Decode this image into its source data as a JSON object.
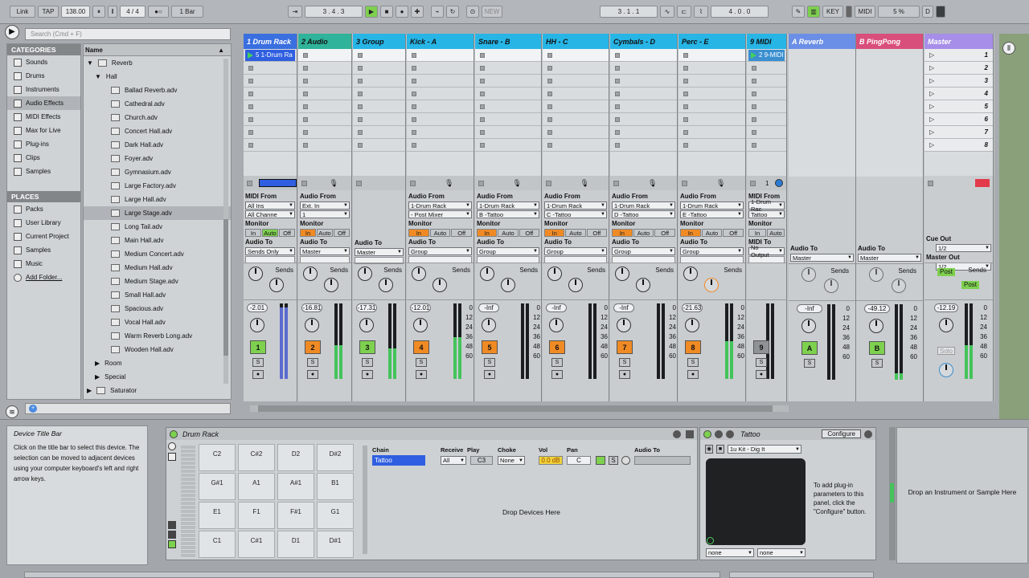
{
  "transport": {
    "link": "Link",
    "tap": "TAP",
    "tempo": "138.00",
    "sig": "4 / 4",
    "quant": "1 Bar",
    "pos1": "3 .  4 .  3",
    "pos2": "3 .  1 .  1",
    "pos3": "4 .  0 .  0",
    "new": "NEW",
    "key": "KEY",
    "midi": "MIDI",
    "cpu": "5 %",
    "d": "D"
  },
  "browser": {
    "search": "Search (Cmd + F)",
    "categories_title": "CATEGORIES",
    "categories": [
      "Sounds",
      "Drums",
      "Instruments",
      "Audio Effects",
      "MIDI Effects",
      "Max for Live",
      "Plug-ins",
      "Clips",
      "Samples"
    ],
    "places_title": "PLACES",
    "places": [
      "Packs",
      "User Library",
      "Current Project",
      "Samples",
      "Music",
      "Add Folder..."
    ],
    "name_col": "Name",
    "reverb": "Reverb",
    "hall": "Hall",
    "files": [
      "Ballad Reverb.adv",
      "Cathedral.adv",
      "Church.adv",
      "Concert Hall.adv",
      "Dark Hall.adv",
      "Foyer.adv",
      "Gymnasium.adv",
      "Large Factory.adv",
      "Large Hall.adv",
      "Large Stage.adv",
      "Long Tail.adv",
      "Main Hall.adv",
      "Medium Concert.adv",
      "Medium Hall.adv",
      "Medium Stage.adv",
      "Small Hall.adv",
      "Spacious.adv",
      "Vocal Hall.adv",
      "Warm Reverb Long.adv",
      "Wooden Hall.adv"
    ],
    "room": "Room",
    "special": "Special",
    "saturator": "Saturator"
  },
  "tracks": [
    {
      "name": "1 Drum Rack",
      "color": "#3a6fe0",
      "clip": "5 1-Drum Ra",
      "from_label": "MIDI From",
      "from": "All Ins",
      "chan": "All Channe",
      "to": "Sends Only",
      "vol": "-2.01",
      "num": "1",
      "numcol": "#7ed04f"
    },
    {
      "name": "2 Audio",
      "color": "#2fb39a",
      "clip": "",
      "from_label": "Audio From",
      "from": "Ext. In",
      "chan": "1",
      "to": "Master",
      "vol": "-16.81",
      "num": "2",
      "numcol": "#f08a24"
    },
    {
      "name": "3 Group",
      "color": "#27b5e6",
      "clip": "",
      "from_label": "",
      "from": "",
      "chan": "",
      "to": "Master",
      "vol": "-17.31",
      "num": "3",
      "numcol": "#7ed04f"
    },
    {
      "name": "Kick - A",
      "color": "#27b5e6",
      "clip": "",
      "from_label": "Audio From",
      "from": "1-Drum Rack",
      "chan": "- Post Mixer",
      "to": "Group",
      "vol": "-12.01",
      "num": "4",
      "numcol": "#f08a24"
    },
    {
      "name": "Snare - B",
      "color": "#27b5e6",
      "clip": "",
      "from_label": "Audio From",
      "from": "1-Drum Rack",
      "chan": "B -Tattoo",
      "to": "Group",
      "vol": "-Inf",
      "num": "5",
      "numcol": "#f08a24"
    },
    {
      "name": "HH - C",
      "color": "#27b5e6",
      "clip": "",
      "from_label": "Audio From",
      "from": "1-Drum Rack",
      "chan": "C -Tattoo",
      "to": "Group",
      "vol": "-Inf",
      "num": "6",
      "numcol": "#f08a24"
    },
    {
      "name": "Cymbals - D",
      "color": "#27b5e6",
      "clip": "",
      "from_label": "Audio From",
      "from": "1-Drum Rack",
      "chan": "D -Tattoo",
      "to": "Group",
      "vol": "-Inf",
      "num": "7",
      "numcol": "#f08a24"
    },
    {
      "name": "Perc - E",
      "color": "#27b5e6",
      "clip": "",
      "from_label": "Audio From",
      "from": "1-Drum Rack",
      "chan": "E -Tattoo",
      "to": "Group",
      "vol": "-21.63",
      "num": "8",
      "numcol": "#f08a24"
    },
    {
      "name": "9 MIDI",
      "color": "#27b5e6",
      "clip": "2 9-MIDI",
      "from_label": "MIDI From",
      "from": "1-Drum Rac",
      "chan": "Tattoo",
      "to": "No Output",
      "vol": "",
      "num": "9",
      "numcol": "#8f9396"
    }
  ],
  "returns": [
    {
      "name": "A Reverb",
      "color": "#6b8fe6",
      "vol": "-Inf",
      "num": "A"
    },
    {
      "name": "B PingPong",
      "color": "#d94f7c",
      "vol": "-49.12",
      "num": "B"
    }
  ],
  "master": {
    "name": "Master",
    "color": "#a78ee8",
    "scenes": [
      "1",
      "2",
      "3",
      "4",
      "5",
      "6",
      "7",
      "8"
    ],
    "cue_label": "Cue Out",
    "cue": "1/2",
    "master_out_label": "Master Out",
    "master_out": "1/2",
    "vol": "-12.19",
    "solo": "Solo",
    "post": "Post"
  },
  "labels": {
    "monitor": "Monitor",
    "in": "In",
    "auto": "Auto",
    "off": "Off",
    "audio_to": "Audio To",
    "sends": "Sends",
    "s": "S",
    "midi_to": "MIDI To"
  },
  "scale": [
    "0",
    "12",
    "24",
    "36",
    "48",
    "60"
  ],
  "info": {
    "title": "Device Title Bar",
    "body": "Click on the title bar to select this device. The selection can be moved to adjacent devices using your computer keyboard's left and right arrow keys."
  },
  "drumrack": {
    "title": "Drum Rack",
    "pads": [
      [
        "C2",
        "C#2",
        "D2",
        "D#2"
      ],
      [
        "G#1",
        "A1",
        "A#1",
        "B1"
      ],
      [
        "E1",
        "F1",
        "F#1",
        "G1"
      ],
      [
        "C1",
        "C#1",
        "D1",
        "D#1"
      ]
    ],
    "cols": {
      "chain": "Chain",
      "receive": "Receive",
      "play": "Play",
      "choke": "Choke",
      "vol": "Vol",
      "pan": "Pan",
      "audio_to": "Audio To"
    },
    "chain": "Tattoo",
    "receive_val": "All",
    "play_val": "C3",
    "choke_val": "None",
    "vol_val": "0.0 dB",
    "pan_val": "C",
    "drop": "Drop Devices Here"
  },
  "tattoo": {
    "title": "Tattoo",
    "configure": "Configure",
    "preset": "1u Kit - Dig It",
    "hint": "To add plug-in parameters to this panel, click the \"Configure\" button.",
    "none1": "none",
    "none2": "none"
  },
  "drop_instrument": "Drop an Instrument or Sample Here"
}
